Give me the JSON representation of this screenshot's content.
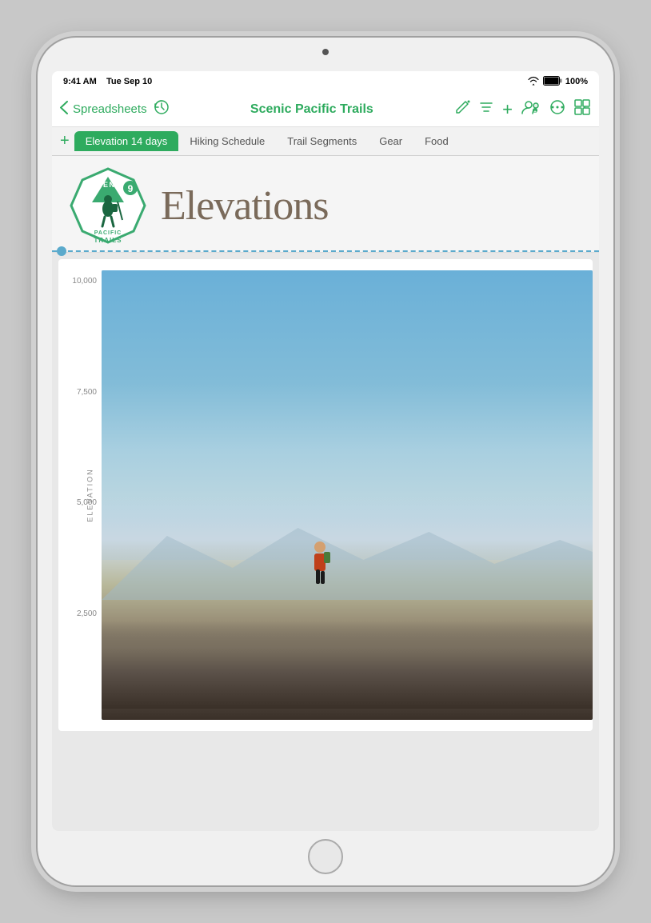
{
  "device": {
    "status_bar": {
      "time": "9:41 AM",
      "date": "Tue Sep 10",
      "battery": "100%",
      "wifi": "wifi"
    }
  },
  "toolbar": {
    "back_label": "Spreadsheets",
    "title": "Scenic Pacific Trails",
    "icons": {
      "pencil": "✎",
      "list": "≡",
      "add": "+",
      "collab": "👤",
      "more": "•••",
      "sheets": "⊞"
    }
  },
  "tabs": [
    {
      "label": "Elevation 14 days",
      "active": true
    },
    {
      "label": "Hiking Schedule",
      "active": false
    },
    {
      "label": "Trail Segments",
      "active": false
    },
    {
      "label": "Gear",
      "active": false
    },
    {
      "label": "Food",
      "active": false
    }
  ],
  "sheet": {
    "logo_text_top": "SCENIC",
    "logo_text_left": "PACIFIC",
    "logo_text_bottom": "TRAILS",
    "logo_number": "9",
    "page_title": "Elevations",
    "chart": {
      "y_axis_label": "ELEVATION",
      "ticks": [
        "10,000",
        "7,500",
        "5,000",
        "2,500",
        ""
      ]
    }
  }
}
